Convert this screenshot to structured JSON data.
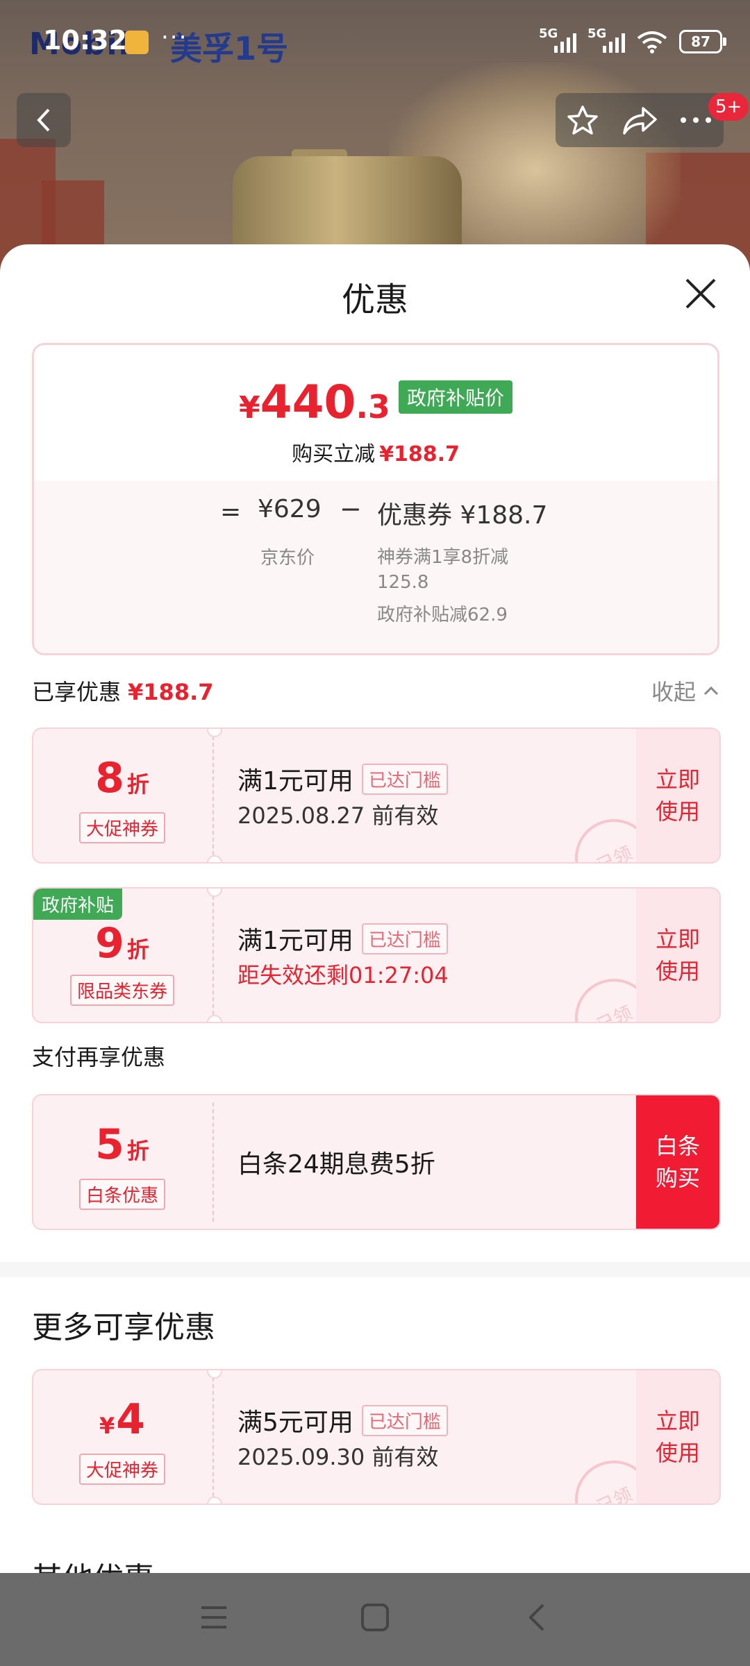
{
  "status_bar": {
    "time": "10:32",
    "notif_dots": "···",
    "net1": "5G",
    "net2": "5G",
    "battery": "87"
  },
  "banner": {
    "brand": "Mobil",
    "brand_sub": "美孚1号"
  },
  "nav": {
    "badge": "5+"
  },
  "sheet": {
    "title": "优惠"
  },
  "summary": {
    "currency": "¥",
    "price_int": "440",
    "price_dec": ".3",
    "gov_tag": "政府补贴价",
    "reduce_label": "购买立减",
    "reduce_amount": "¥188.7",
    "equals": "=",
    "jd_price": "¥629",
    "jd_label": "京东价",
    "minus": "−",
    "coupon_total": "优惠券 ¥188.7",
    "coupon_detail_1": "神券满1享8折减125.8",
    "coupon_detail_2": "政府补贴减62.9"
  },
  "enjoyed": {
    "label": "已享优惠",
    "amount": "¥188.7",
    "collapse": "收起"
  },
  "coupons": [
    {
      "value": "8",
      "unit": "折",
      "tag": "大促神券",
      "condition": "满1元可用",
      "met": "已达门槛",
      "sub": "2025.08.27 前有效",
      "action": "立即使用",
      "stamp": "已领"
    },
    {
      "corner": "政府补贴",
      "value": "9",
      "unit": "折",
      "tag": "限品类东券",
      "condition": "满1元可用",
      "met": "已达门槛",
      "sub": "距失效还剩01:27:04",
      "action": "立即使用",
      "stamp": "已领"
    }
  ],
  "pay_section": {
    "label": "支付再享优惠",
    "value": "5",
    "unit": "折",
    "tag": "白条优惠",
    "condition": "白条24期息费5折",
    "action": "白条购买"
  },
  "more_section": {
    "label": "更多可享优惠",
    "currency": "¥",
    "value": "4",
    "tag": "大促神券",
    "condition": "满5元可用",
    "met": "已达门槛",
    "sub": "2025.09.30 前有效",
    "action": "立即使用",
    "stamp": "已领"
  },
  "other_section": {
    "label": "其他优惠"
  },
  "colors": {
    "accent_red": "#e8232f",
    "gov_green": "#3fa956",
    "button_red": "#f21b34"
  }
}
